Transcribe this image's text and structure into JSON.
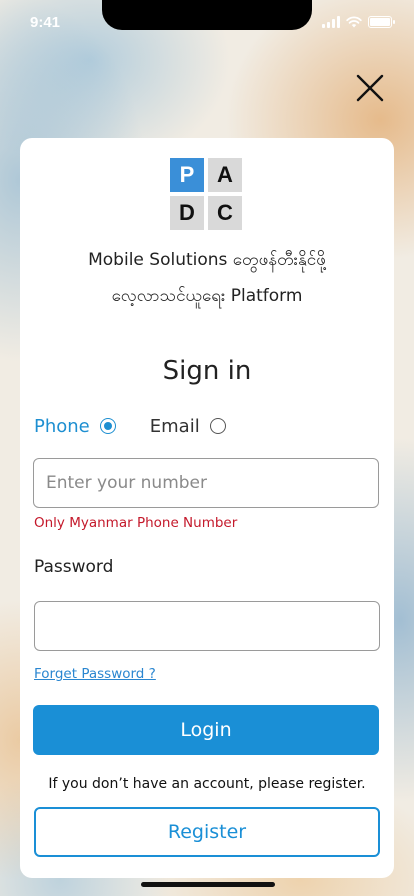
{
  "status_bar": {
    "time": "9:41"
  },
  "logo": {
    "letters": [
      "P",
      "A",
      "D",
      "C"
    ]
  },
  "tagline": {
    "line1": "Mobile  Solutions  တွေဖန်တီးနိုင်ဖို့",
    "line2": "လေ့လာသင်ယူရေး  Platform"
  },
  "form": {
    "title": "Sign in",
    "method_phone": "Phone",
    "method_email": "Email",
    "phone_placeholder": "Enter your number",
    "phone_hint": "Only Myanmar Phone Number",
    "password_label": "Password",
    "password_value": "",
    "forgot_label": "Forget Password ?",
    "login_label": "Login",
    "register_note": "If you don’t have an account, please register.",
    "register_label": "Register"
  },
  "colors": {
    "accent": "#1a8fd6",
    "error": "#c4192b",
    "logo_blue": "#3a8fd8"
  },
  "icons": {
    "close": "close-icon"
  }
}
